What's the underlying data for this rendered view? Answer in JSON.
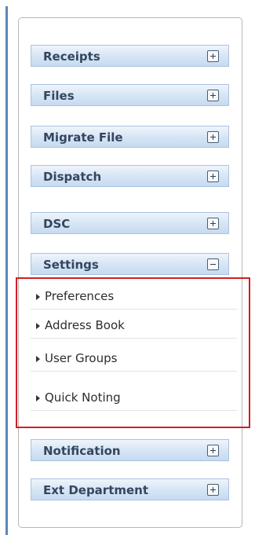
{
  "sidebar": {
    "sections": [
      {
        "label": "Receipts",
        "expanded": false
      },
      {
        "label": "Files",
        "expanded": false
      },
      {
        "label": "Migrate File",
        "expanded": false
      },
      {
        "label": "Dispatch",
        "expanded": false
      },
      {
        "label": "DSC",
        "expanded": false
      },
      {
        "label": "Settings",
        "expanded": true
      },
      {
        "label": "Notification",
        "expanded": false
      },
      {
        "label": "Ext Department",
        "expanded": false
      }
    ],
    "settings_items": [
      {
        "label": "Preferences"
      },
      {
        "label": "Address Book"
      },
      {
        "label": "User Groups"
      },
      {
        "label": "Quick Noting"
      }
    ]
  },
  "colors": {
    "header_gradient_top": "#eff5fc",
    "header_gradient_bottom": "#c6daf0",
    "header_text": "#34465f",
    "highlight_border": "#d11f26",
    "frame_border": "#5b86b9"
  },
  "icons": {
    "collapsed": "plus-box-icon",
    "expanded": "minus-box-icon",
    "submenu": "triangle-right-icon"
  }
}
